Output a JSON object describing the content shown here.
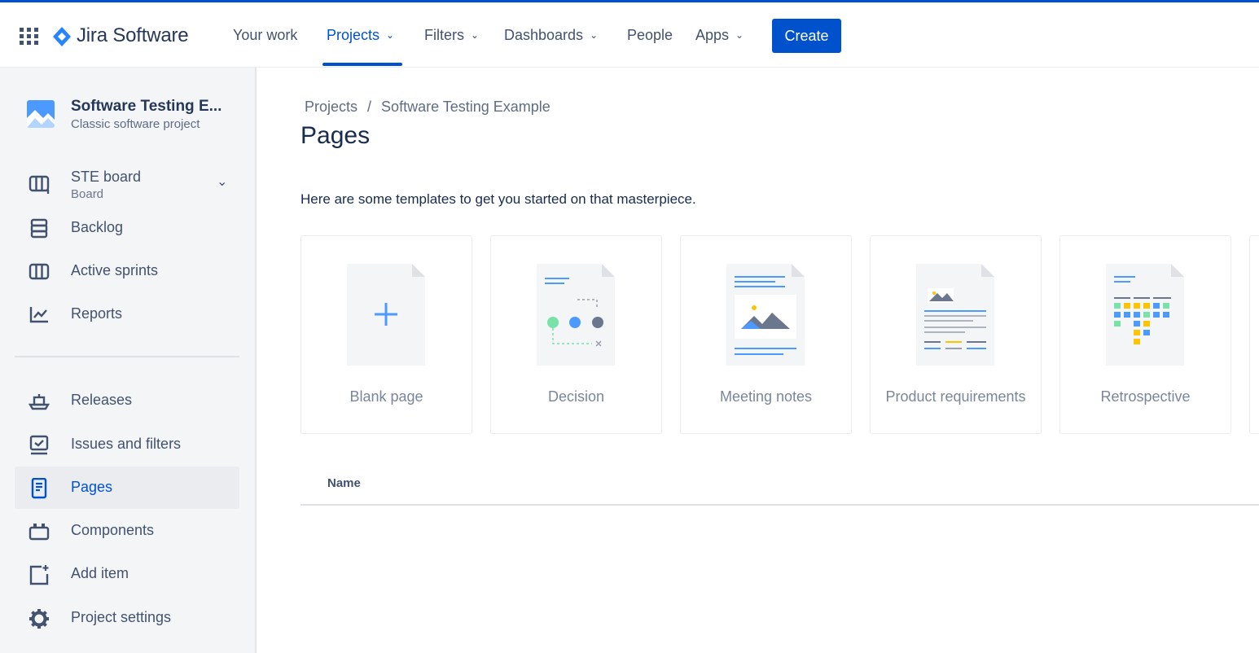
{
  "brand": {
    "name": "Jira Software",
    "color": "#0052cc"
  },
  "topnav": {
    "items": [
      {
        "label": "Your work"
      },
      {
        "label": "Projects",
        "active": true
      },
      {
        "label": "Filters"
      },
      {
        "label": "Dashboards"
      },
      {
        "label": "People"
      },
      {
        "label": "Apps"
      }
    ],
    "create_label": "Create"
  },
  "sidebar": {
    "project": {
      "name": "Software Testing E...",
      "type": "Classic software project"
    },
    "board": {
      "label": "STE board",
      "sub": "Board"
    },
    "items": [
      {
        "label": "Backlog",
        "icon": "backlog-icon"
      },
      {
        "label": "Active sprints",
        "icon": "active-sprints-icon"
      },
      {
        "label": "Reports",
        "icon": "reports-icon"
      },
      {
        "label": "Releases",
        "icon": "releases-icon"
      },
      {
        "label": "Issues and filters",
        "icon": "issues-icon"
      },
      {
        "label": "Pages",
        "icon": "pages-icon",
        "active": true
      },
      {
        "label": "Components",
        "icon": "components-icon"
      },
      {
        "label": "Add item",
        "icon": "add-item-icon"
      },
      {
        "label": "Project settings",
        "icon": "gear-icon"
      }
    ]
  },
  "main": {
    "breadcrumb": [
      "Projects",
      "/",
      "Software Testing Example"
    ],
    "title": "Pages",
    "intro": "Here are some templates to get you started on that masterpiece.",
    "templates": [
      {
        "label": "Blank page"
      },
      {
        "label": "Decision"
      },
      {
        "label": "Meeting notes"
      },
      {
        "label": "Product requirements"
      },
      {
        "label": "Retrospective"
      }
    ],
    "table": {
      "name_header": "Name"
    }
  }
}
